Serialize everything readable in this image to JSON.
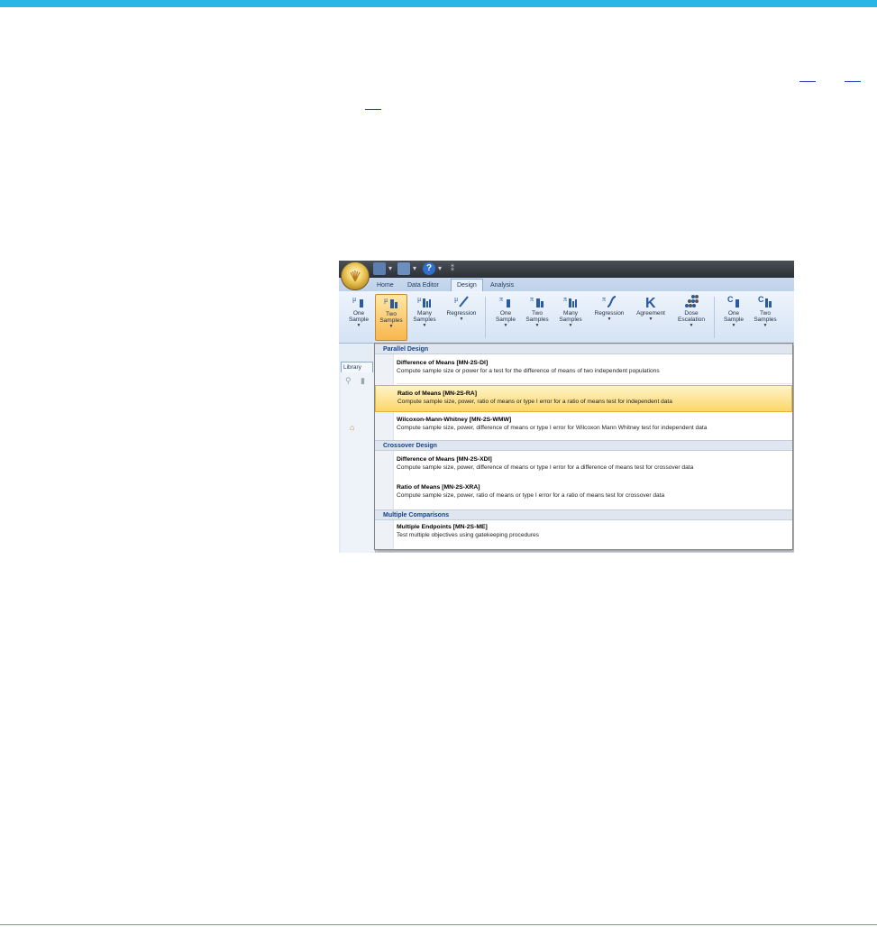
{
  "page": {
    "accent_color": "#29b6e6"
  },
  "window": {
    "app_icon": "pass-logo-icon",
    "quick_access": [
      "save-icon",
      "print-icon",
      "help-icon",
      "customize-arrow-icon"
    ]
  },
  "tabs": [
    {
      "label": "Home",
      "active": false
    },
    {
      "label": "Data Editor",
      "active": false
    },
    {
      "label": "Design",
      "active": true
    },
    {
      "label": "Analysis",
      "active": false
    }
  ],
  "ribbon": {
    "groups": [
      {
        "buttons": [
          {
            "label": [
              "One",
              "Sample"
            ],
            "icon": "one-sample-icon"
          },
          {
            "label": [
              "Two",
              "Samples"
            ],
            "icon": "two-samples-icon",
            "selected": true
          },
          {
            "label": [
              "Many",
              "Samples"
            ],
            "icon": "many-samples-icon"
          },
          {
            "label": [
              "Regression",
              ""
            ],
            "icon": "regression-icon"
          }
        ]
      },
      {
        "buttons": [
          {
            "label": [
              "One",
              "Sample"
            ],
            "icon": "one-sample-proportion-icon"
          },
          {
            "label": [
              "Two",
              "Samples"
            ],
            "icon": "two-samples-proportion-icon"
          },
          {
            "label": [
              "Many",
              "Samples"
            ],
            "icon": "many-samples-proportion-icon"
          },
          {
            "label": [
              "Regression",
              ""
            ],
            "icon": "logistic-regression-icon"
          },
          {
            "label": [
              "Agreement",
              ""
            ],
            "icon": "kappa-agreement-icon"
          },
          {
            "label": [
              "Dose",
              "Escalation"
            ],
            "icon": "dose-escalation-icon"
          }
        ]
      },
      {
        "buttons": [
          {
            "label": [
              "One",
              "Sample"
            ],
            "icon": "one-sample-count-icon"
          },
          {
            "label": [
              "Two",
              "Samples"
            ],
            "icon": "two-samples-count-icon"
          }
        ]
      }
    ]
  },
  "library": {
    "tab_label": "Library"
  },
  "menu": {
    "sections": [
      {
        "header": "Parallel Design",
        "items": [
          {
            "title": "Difference of Means [MN-2S-DI]",
            "desc": "Compute sample size or power for a test for the difference of means of two independent populations",
            "highlighted": false
          },
          {
            "title": "Ratio of Means [MN-2S-RA]",
            "desc": "Compute sample size, power, ratio of means or type I error for a ratio of means test for independent data",
            "highlighted": true
          },
          {
            "title": "Wilcoxon-Mann-Whitney [MN-2S-WMW]",
            "desc": "Compute sample size, power, difference of means or type I error for Wilcoxon Mann Whitney test for independent data",
            "highlighted": false
          }
        ]
      },
      {
        "header": "Crossover Design",
        "items": [
          {
            "title": "Difference of Means [MN-2S-XDI]",
            "desc": "Compute sample size, power, difference of means or type I error for a difference of means test for crossover data",
            "highlighted": false
          },
          {
            "title": "Ratio of Means [MN-2S-XRA]",
            "desc": "Compute sample size, power, ratio of means or type I error for a ratio of means test for crossover data",
            "highlighted": false
          }
        ]
      },
      {
        "header": "Multiple Comparisons",
        "items": [
          {
            "title": "Multiple Endpoints [MN-2S-ME]",
            "desc": "Test multiple objectives using gatekeeping procedures",
            "highlighted": false
          }
        ]
      }
    ]
  }
}
